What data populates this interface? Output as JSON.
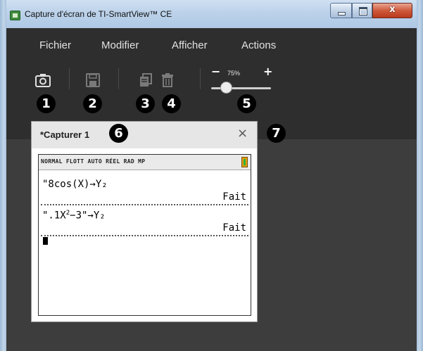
{
  "window": {
    "title": "Capture d'écran de TI-SmartView™ CE",
    "close_glyph": "x"
  },
  "menu": [
    "Fichier",
    "Modifier",
    "Afficher",
    "Actions"
  ],
  "toolbar": {
    "icons": [
      "camera-icon",
      "save-icon",
      "copy-icon",
      "trash-icon"
    ],
    "zoom": {
      "value_label": "75%",
      "minus": "−",
      "plus": "+",
      "level": 0.25
    }
  },
  "callouts": [
    "1",
    "2",
    "3",
    "4",
    "5",
    "6",
    "7"
  ],
  "capture_panel": {
    "title": "*Capturer 1",
    "close_glyph": "×",
    "screen": {
      "status": "NORMAL FLOTT AUTO RÉEL RAD MP",
      "line1": "\"8cos(X)→Y₂",
      "result1": "Fait",
      "line2_a": "\".1X",
      "line2_exp": "2",
      "line2_b": "−3\"→Y₂",
      "result2": "Fait"
    }
  },
  "colors": {
    "client_bg": "#3d3d3d",
    "toolbar_bg": "#2e2e2e",
    "battery": "#e39d10"
  }
}
